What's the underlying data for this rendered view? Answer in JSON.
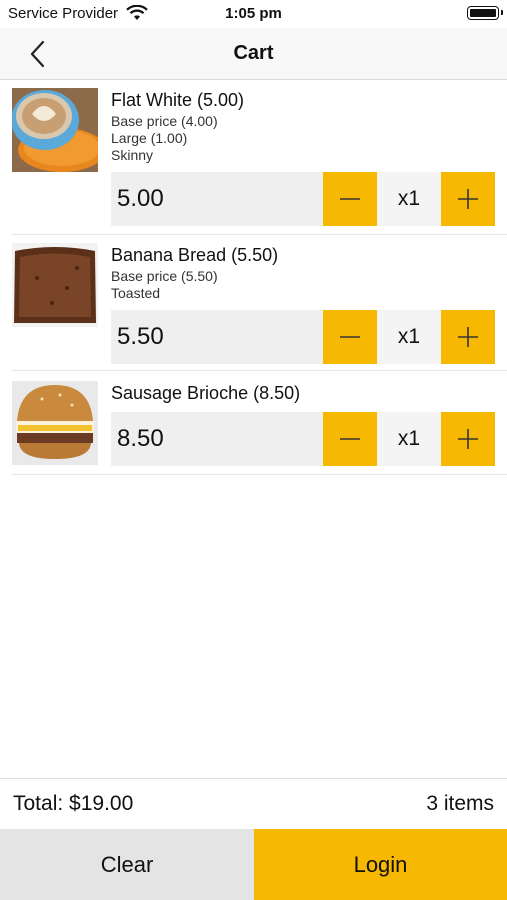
{
  "status_bar": {
    "carrier": "Service Provider",
    "time": "1:05 pm"
  },
  "nav": {
    "title": "Cart",
    "back_icon": "chevron-left-icon"
  },
  "accent_color": "#f6b800",
  "cart": {
    "items": [
      {
        "name": "Flat White (5.00)",
        "details": [
          "Base price (4.00)",
          "Large (1.00)",
          "Skinny"
        ],
        "price": "5.00",
        "quantity": "x1",
        "image": "flat-white-coffee"
      },
      {
        "name": "Banana Bread (5.50)",
        "details": [
          "Base price (5.50)",
          "Toasted"
        ],
        "price": "5.50",
        "quantity": "x1",
        "image": "banana-bread-slice"
      },
      {
        "name": "Sausage Brioche (8.50)",
        "details": [],
        "price": "8.50",
        "quantity": "x1",
        "image": "sausage-brioche-burger"
      }
    ]
  },
  "footer": {
    "total": "Total: $19.00",
    "count": "3 items",
    "clear_label": "Clear",
    "login_label": "Login"
  }
}
